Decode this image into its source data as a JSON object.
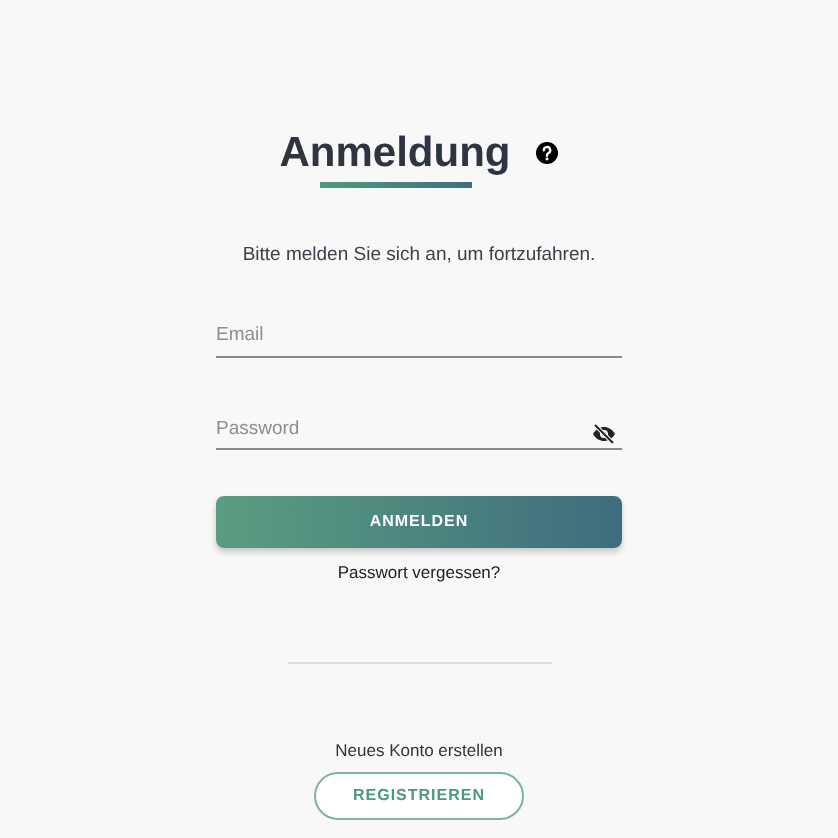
{
  "title": "Anmeldung",
  "subtitle": "Bitte melden Sie sich an, um fortzufahren.",
  "fields": [
    {
      "kind": "text",
      "placeholder": "Email"
    },
    {
      "kind": "password",
      "placeholder": "Password"
    }
  ],
  "login_button": "ANMELDEN",
  "forgot_link": "Passwort vergessen?",
  "register_prompt": "Neues Konto erstellen",
  "register_button": "REGISTRIEREN"
}
